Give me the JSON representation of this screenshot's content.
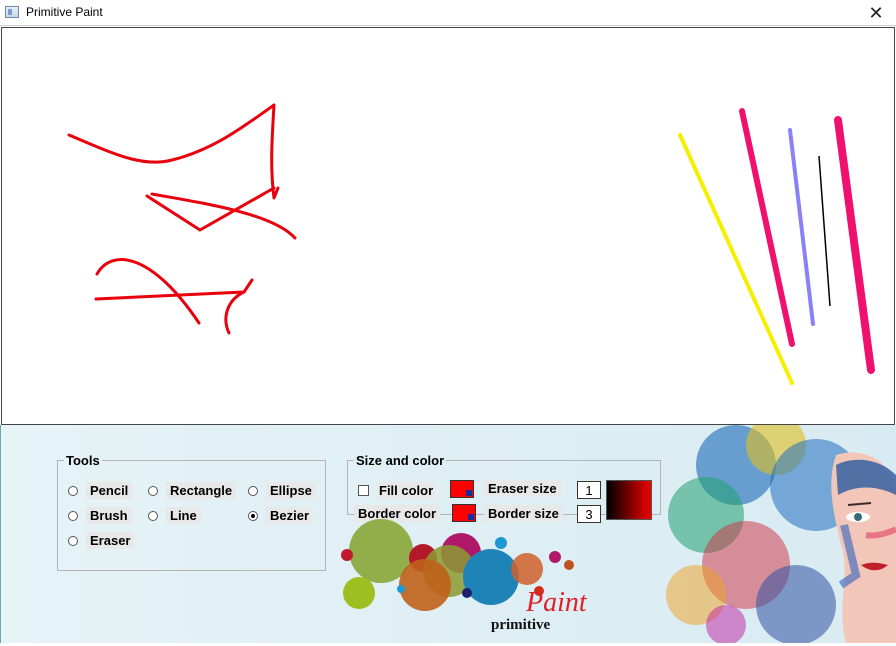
{
  "window": {
    "title": "Primitive Paint",
    "close_glyph": "✕"
  },
  "tools": {
    "legend": "Tools",
    "options": [
      {
        "label": "Pencil",
        "selected": false
      },
      {
        "label": "Rectangle",
        "selected": false
      },
      {
        "label": "Ellipse",
        "selected": false
      },
      {
        "label": "Brush",
        "selected": false
      },
      {
        "label": "Line",
        "selected": false
      },
      {
        "label": "Bezier",
        "selected": true
      },
      {
        "label": "Eraser",
        "selected": false
      }
    ]
  },
  "size_color": {
    "legend": "Size and color",
    "fill_color_label": "Fill color",
    "fill_checked": false,
    "border_color_label": "Border color",
    "eraser_size_label": "Eraser size",
    "eraser_size_value": "1",
    "border_size_label": "Border size",
    "border_size_value": "3",
    "fill_color": "#ff0000",
    "border_color": "#ff0000"
  },
  "logo": {
    "paint_text": "Paint",
    "primitive_text": "primitive"
  },
  "colors": {
    "stroke_red": "#e8000d",
    "yellow": "#f5ef00",
    "pink": "#f0106e",
    "lavender": "#8a80f8",
    "black": "#000000"
  }
}
